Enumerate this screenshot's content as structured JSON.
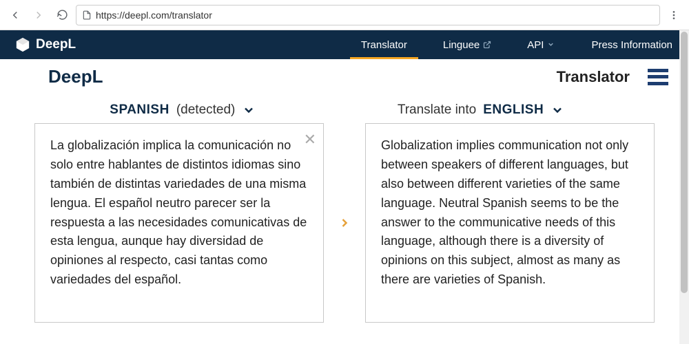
{
  "browser": {
    "url": "https://deepl.com/translator"
  },
  "nav": {
    "brand": "DeepL",
    "links": {
      "translator": "Translator",
      "linguee": "Linguee",
      "api": "API",
      "press": "Press Information"
    }
  },
  "subheader": {
    "brand": "DeepL",
    "title": "Translator"
  },
  "source": {
    "lang_label": "SPANISH",
    "detected_suffix": "(detected)",
    "text": "La globalización implica la comunicación no solo entre hablantes de distintos idiomas sino también de distintas variedades de una misma lengua. El español neutro parecer ser la respuesta a las necesidades comunicativas de esta lengua, aunque hay diversidad de opiniones al respecto, casi tantas como variedades del español."
  },
  "target": {
    "prefix": "Translate into",
    "lang_label": "ENGLISH",
    "text": "Globalization implies communication not only between speakers of different languages, but also between different varieties of the same language. Neutral Spanish seems to be the answer to the communicative needs of this language, although there is a diversity of opinions on this subject, almost as many as there are varieties of Spanish."
  }
}
